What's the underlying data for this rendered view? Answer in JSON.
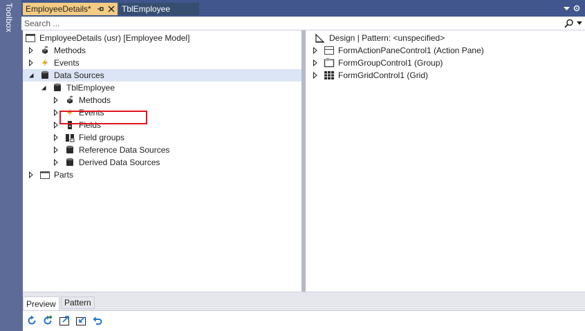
{
  "toolbox": {
    "label": "Toolbox"
  },
  "tabs": {
    "active": {
      "label": "EmployeeDetails*"
    },
    "inactive": {
      "label": "TblEmployee"
    }
  },
  "search": {
    "placeholder": "Search ..."
  },
  "left_tree": {
    "root": "EmployeeDetails (usr) [Employee Model]",
    "methods": "Methods",
    "events": "Events",
    "data_sources": "Data Sources",
    "tbl_employee": "TblEmployee",
    "tbl_children": {
      "methods": "Methods",
      "events": "Events",
      "fields": "Fields",
      "field_groups": "Field groups",
      "reference_data_sources": "Reference Data Sources",
      "derived_data_sources": "Derived Data Sources"
    },
    "parts": "Parts"
  },
  "right_tree": {
    "design": "Design | Pattern: <unspecified>",
    "action_pane": "FormActionPaneControl1 (Action Pane)",
    "group": "FormGroupControl1 (Group)",
    "grid": "FormGridControl1 (Grid)"
  },
  "bottom_tabs": {
    "preview": "Preview",
    "pattern": "Pattern"
  },
  "colors": {
    "accent_tab": "#f5cc84",
    "chrome": "#5d6b99",
    "selection": "#dbe5f5",
    "highlight": "#e0141e"
  },
  "icons": [
    "pin-icon",
    "close-icon",
    "search-icon",
    "refresh-icon",
    "refresh-green-icon",
    "open-icon",
    "export-icon",
    "undo-icon"
  ]
}
